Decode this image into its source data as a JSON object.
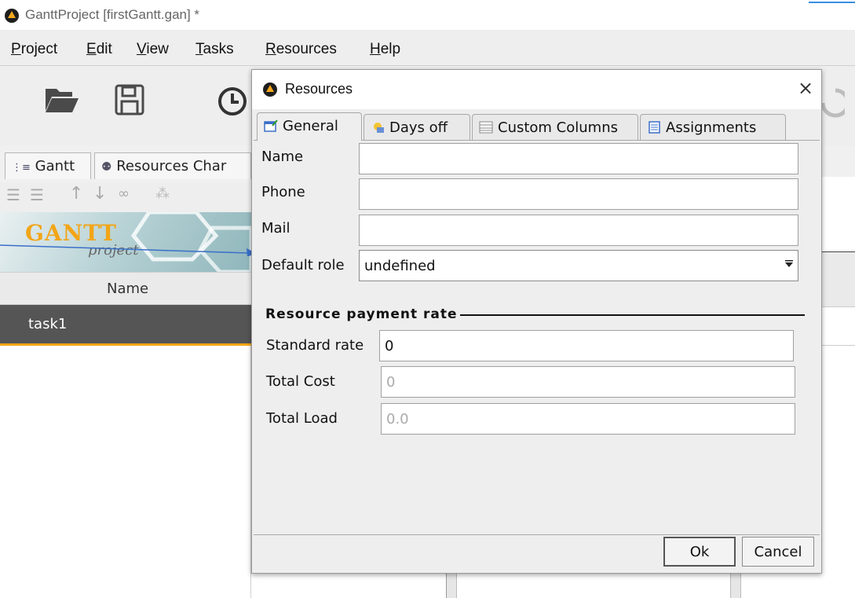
{
  "app": {
    "title": "GanttProject [firstGantt.gan] *"
  },
  "menu": [
    {
      "label": "Project"
    },
    {
      "label": "Edit"
    },
    {
      "label": "View"
    },
    {
      "label": "Tasks"
    },
    {
      "label": "Resources"
    },
    {
      "label": "Help"
    }
  ],
  "left_panel": {
    "tabs": [
      {
        "label": "Gantt"
      },
      {
        "label": "Resources Char"
      }
    ],
    "banner": {
      "logo_text": "GANTT",
      "logo_sub": "project"
    },
    "column_header": "Name",
    "selected_row": "task1"
  },
  "dialog": {
    "title": "Resources",
    "close_glyph": "×",
    "tabs": [
      {
        "label": "General",
        "icon": "general-icon",
        "active": true
      },
      {
        "label": "Days off",
        "icon": "days-off-icon",
        "active": false
      },
      {
        "label": "Custom Columns",
        "icon": "custom-columns-icon",
        "active": false
      },
      {
        "label": "Assignments",
        "icon": "assignments-icon",
        "active": false
      }
    ],
    "fields": {
      "name": {
        "label": "Name",
        "value": ""
      },
      "phone": {
        "label": "Phone",
        "value": ""
      },
      "mail": {
        "label": "Mail",
        "value": ""
      },
      "default_role": {
        "label": "Default role",
        "value": "undefined"
      }
    },
    "payment": {
      "section_title": "Resource payment rate",
      "standard_rate": {
        "label": "Standard rate",
        "value": "0"
      },
      "total_cost": {
        "label": "Total Cost",
        "value": "0"
      },
      "total_load": {
        "label": "Total Load",
        "value": "0.0"
      }
    },
    "buttons": {
      "ok": "Ok",
      "cancel": "Cancel"
    }
  },
  "colors": {
    "accent_orange": "#f2a517",
    "selection_gray": "#555555",
    "annotation_arrow": "#3a6fc9"
  }
}
